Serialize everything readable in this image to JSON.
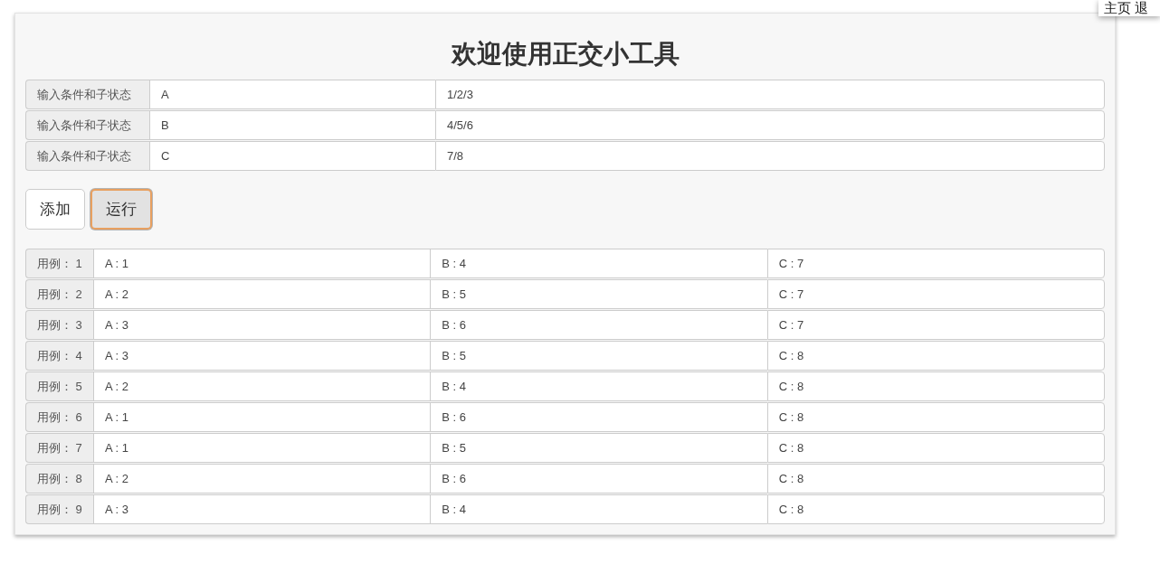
{
  "top_links": [
    {
      "label": "主页"
    },
    {
      "label": "退"
    }
  ],
  "title": "欢迎使用正交小工具",
  "factors": [
    {
      "label": "输入条件和子状态",
      "name": "A",
      "states": "1/2/3"
    },
    {
      "label": "输入条件和子状态",
      "name": "B",
      "states": "4/5/6"
    },
    {
      "label": "输入条件和子状态",
      "name": "C",
      "states": "7/8"
    }
  ],
  "buttons": [
    {
      "label": "添加",
      "focused": false
    },
    {
      "label": "运行",
      "focused": true
    }
  ],
  "cases": [
    {
      "label": "用例： 1",
      "cells": [
        "A : 1",
        "B : 4",
        "C : 7"
      ]
    },
    {
      "label": "用例： 2",
      "cells": [
        "A : 2",
        "B : 5",
        "C : 7"
      ]
    },
    {
      "label": "用例： 3",
      "cells": [
        "A : 3",
        "B : 6",
        "C : 7"
      ]
    },
    {
      "label": "用例： 4",
      "cells": [
        "A : 3",
        "B : 5",
        "C : 8"
      ]
    },
    {
      "label": "用例： 5",
      "cells": [
        "A : 2",
        "B : 4",
        "C : 8"
      ]
    },
    {
      "label": "用例： 6",
      "cells": [
        "A : 1",
        "B : 6",
        "C : 8"
      ]
    },
    {
      "label": "用例： 7",
      "cells": [
        "A : 1",
        "B : 5",
        "C : 8"
      ]
    },
    {
      "label": "用例： 8",
      "cells": [
        "A : 2",
        "B : 6",
        "C : 8"
      ]
    },
    {
      "label": "用例： 9",
      "cells": [
        "A : 3",
        "B : 4",
        "C : 8"
      ]
    }
  ]
}
